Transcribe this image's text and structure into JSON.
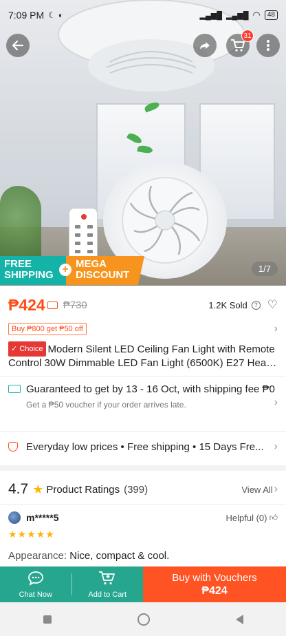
{
  "status_bar": {
    "time": "7:09 PM",
    "battery": "48"
  },
  "header": {
    "cart_count": "31"
  },
  "hero": {
    "promo_free": "FREE SHIPPING",
    "promo_mega": "MEGA DISCOUNT",
    "image_counter": "1/7"
  },
  "product": {
    "price_current": "₱424",
    "price_original": "₱730",
    "sold": "1.2K Sold",
    "coupon": "Buy ₱800 get ₱50 off",
    "choice_badge": "✓ Choice",
    "title": "Modern Silent LED Ceiling Fan Light with Remote Control 30W Dimmable LED Fan Light (6500K) E27 Head ..."
  },
  "shipping": {
    "main": "Guaranteed to get by 13 - 16 Oct, with shipping fee ₱0",
    "sub": "Get a ₱50 voucher if your order arrives late."
  },
  "benefits": {
    "text": "Everyday low prices  •  Free shipping  •  15 Days Fre..."
  },
  "ratings": {
    "score": "4.7",
    "title": "Product Ratings",
    "count": "(399)",
    "view_all": "View All"
  },
  "review": {
    "reviewer": "m*****5",
    "helpful": "Helpful (0)",
    "stars": "★★★★★",
    "appearance_label": "Appearance: ",
    "appearance_value": "Nice, compact & cool."
  },
  "bottom_bar": {
    "chat": "Chat Now",
    "cart": "Add to Cart",
    "buy_line1": "Buy with Vouchers",
    "buy_line2": "₱424"
  },
  "colors": {
    "price": "#ff4d17",
    "teal": "#27a68f",
    "buy": "#ff5324",
    "free_shipping": "#13b3a8",
    "mega_discount": "#f7941d"
  }
}
